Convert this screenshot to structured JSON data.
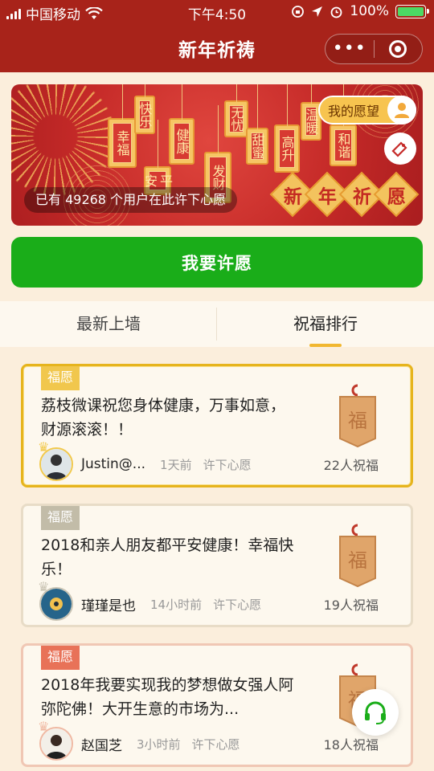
{
  "status_bar": {
    "carrier": "中国移动",
    "time": "下午4:50",
    "battery": "100%",
    "battery_level": 1.0
  },
  "nav": {
    "title": "新年祈祷",
    "more_icon": "more-dots-icon",
    "close_icon": "target-close-icon"
  },
  "banner": {
    "tags": [
      "幸福",
      "快乐",
      "平安",
      "健康",
      "发财",
      "无忧",
      "甜蜜",
      "高升",
      "温暖",
      "和谐"
    ],
    "stat_text": "已有 49268 个用户在此许下心愿",
    "headline": [
      "新",
      "年",
      "祈",
      "愿"
    ],
    "my_wish": "我的愿望"
  },
  "wish_button": "我要许愿",
  "tabs": [
    {
      "label": "最新上墙",
      "active": false
    },
    {
      "label": "祝福排行",
      "active": true
    }
  ],
  "wishes": [
    {
      "label": "福愿",
      "text": "荔枝微课祝您身体健康，万事如意，财源滚滚！！",
      "user": "Justin@...",
      "time": "1天前",
      "action": "许下心愿",
      "count": "22人祝福"
    },
    {
      "label": "福愿",
      "text": "2018和亲人朋友都平安健康！幸福快乐！",
      "user": "瑾瑾是也",
      "time": "14小时前",
      "action": "许下心愿",
      "count": "19人祝福"
    },
    {
      "label": "福愿",
      "text": "2018年我要实现我的梦想做女强人阿弥陀佛！大开生意的市场为...",
      "user": "赵国芝",
      "time": "3小时前",
      "action": "许下心愿",
      "count": "18人祝福"
    }
  ],
  "plaque_char": "福"
}
